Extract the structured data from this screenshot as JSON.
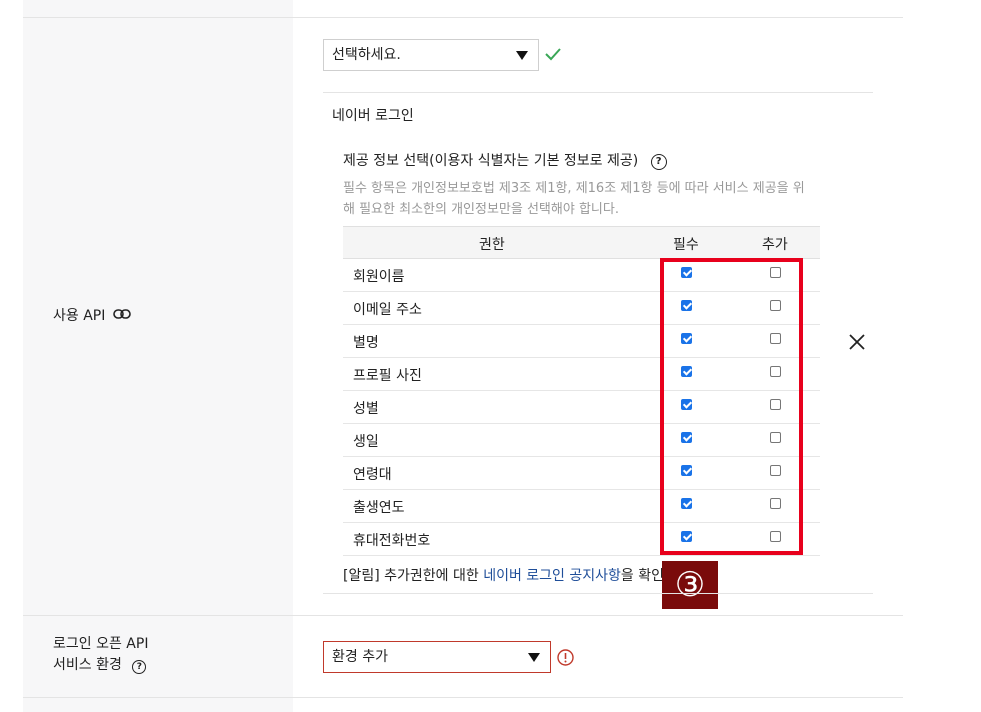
{
  "left": {
    "api_label": "사용 API",
    "openapi_label_line1": "로그인 오픈 API",
    "openapi_label_line2": "서비스 환경"
  },
  "api_select": {
    "value": "선택하세요."
  },
  "login": {
    "section_title": "네이버 로그인",
    "info_title": "제공 정보 선택(이용자 식별자는 기본 정보로 제공)",
    "info_help": "?",
    "desc_line1": "필수 항목은 개인정보보호법 제3조 제1항, 제16조 제1항 등에 따라 서비스 제공을 위",
    "desc_line2": "해 필요한 최소한의 개인정보만을 선택해야 합니다."
  },
  "table": {
    "headers": {
      "permission": "권한",
      "required": "필수",
      "additional": "추가"
    },
    "rows": [
      {
        "label": "회원이름",
        "required": true,
        "additional": false
      },
      {
        "label": "이메일 주소",
        "required": true,
        "additional": false
      },
      {
        "label": "별명",
        "required": true,
        "additional": false
      },
      {
        "label": "프로필 사진",
        "required": true,
        "additional": false
      },
      {
        "label": "성별",
        "required": true,
        "additional": false
      },
      {
        "label": "생일",
        "required": true,
        "additional": false
      },
      {
        "label": "연령대",
        "required": true,
        "additional": false
      },
      {
        "label": "출생연도",
        "required": true,
        "additional": false
      },
      {
        "label": "휴대전화번호",
        "required": true,
        "additional": false
      }
    ]
  },
  "notice": {
    "prefix": "[알림] 추가권한에 대한 ",
    "link": "네이버 로그인 공지사항",
    "suffix": "을 확인"
  },
  "badge": {
    "text": "③"
  },
  "env_select": {
    "value": "환경 추가"
  },
  "colors": {
    "highlight": "#e8001c",
    "badge_bg": "#7a0b0b",
    "link": "#1f4e99",
    "check_ok": "#3aa757",
    "warn": "#c0392b"
  }
}
